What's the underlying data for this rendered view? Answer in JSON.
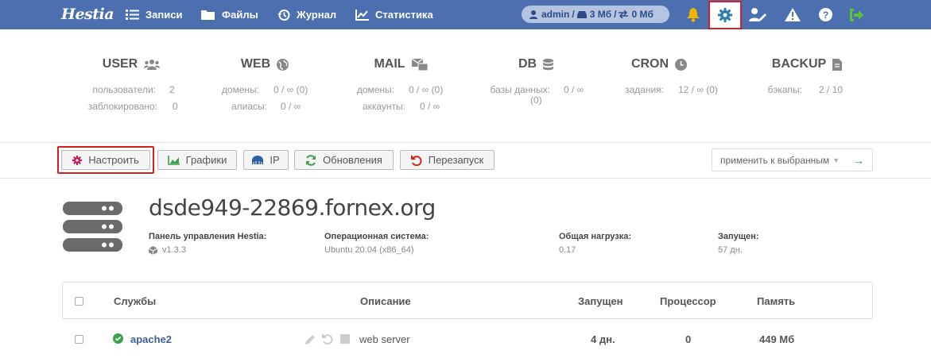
{
  "topbar": {
    "logo": "Hestia",
    "nav": [
      {
        "label": "Записи",
        "icon": "list-icon"
      },
      {
        "label": "Файлы",
        "icon": "folder-icon"
      },
      {
        "label": "Журнал",
        "icon": "history-icon"
      },
      {
        "label": "Статистика",
        "icon": "chart-icon"
      }
    ],
    "user": {
      "name": "admin",
      "disk": "3 Мб",
      "bandwidth": "0 Мб"
    },
    "icons": [
      "bell-icon",
      "gear-icon",
      "user-edit-icon",
      "warning-icon",
      "help-icon",
      "logout-icon"
    ],
    "colors": {
      "bar": "#4c6faf",
      "bell": "#f5b400",
      "logout": "#5bc236"
    }
  },
  "stats": [
    {
      "title": "USER",
      "icon": "users-icon",
      "rows": [
        [
          "пользователи:",
          "2"
        ],
        [
          "заблокировано:",
          "0"
        ]
      ]
    },
    {
      "title": "WEB",
      "icon": "globe-icon",
      "rows": [
        [
          "домены:",
          "0 / ∞ (0)"
        ],
        [
          "алиасы:",
          "0 / ∞"
        ]
      ]
    },
    {
      "title": "MAIL",
      "icon": "mail-icon",
      "rows": [
        [
          "домены:",
          "0 / ∞ (0)"
        ],
        [
          "аккаунты:",
          "0 / ∞"
        ]
      ]
    },
    {
      "title": "DB",
      "icon": "database-icon",
      "rows": [
        [
          "базы данных:",
          "0 / ∞"
        ]
      ],
      "extra": "(0)"
    },
    {
      "title": "CRON",
      "icon": "clock-icon",
      "rows": [
        [
          "задания:",
          "12 / ∞ (0)"
        ]
      ]
    },
    {
      "title": "BACKUP",
      "icon": "file-icon",
      "rows": [
        [
          "бэкапы:",
          "2 / 10"
        ]
      ]
    }
  ],
  "toolbar": {
    "configure": "Настроить",
    "graphs": "Графики",
    "ip": "IP",
    "updates": "Обновления",
    "restart": "Перезапуск",
    "bulk": "применить к выбранным"
  },
  "server": {
    "hostname": "dsde949-22869.fornex.org",
    "panel_label": "Панель управления Hestia:",
    "panel_value": "v1.3.3",
    "os_label": "Операционная система:",
    "os_value": "Ubuntu 20.04 (x86_64)",
    "load_label": "Общая нагрузка:",
    "load_value": "0.17",
    "uptime_label": "Запущен:",
    "uptime_value": "57 дн."
  },
  "table": {
    "headers": {
      "services": "Службы",
      "description": "Описание",
      "uptime": "Запущен",
      "cpu": "Процессор",
      "memory": "Память"
    },
    "rows": [
      {
        "name": "apache2",
        "description": "web server",
        "uptime": "4 дн.",
        "cpu": "0",
        "memory": "449 Мб",
        "status": "running"
      }
    ]
  }
}
